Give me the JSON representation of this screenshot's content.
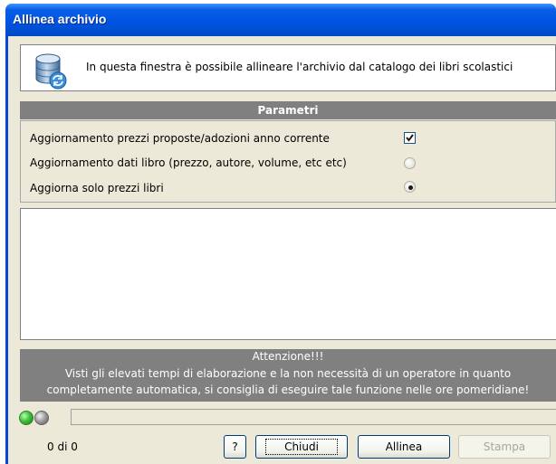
{
  "window": {
    "title": "Allinea archivio"
  },
  "info": {
    "text": "In questa finestra è possibile allineare l'archivio dal catalogo dei libri scolastici",
    "icon": "database-sync-icon"
  },
  "parameters": {
    "header": "Parametri",
    "options": [
      {
        "label": "Aggiornamento prezzi proposte/adozioni anno corrente",
        "control": "checkbox",
        "checked": true
      },
      {
        "label": "Aggiornamento dati libro (prezzo, autore, volume, etc etc)",
        "control": "radio",
        "checked": false
      },
      {
        "label": "Aggiorna solo prezzi libri",
        "control": "radio",
        "checked": true
      }
    ]
  },
  "warning": {
    "title": "Attenzione!!!",
    "line1": "Visti gli elevati tempi di elaborazione e la non necessità di un operatore in quanto",
    "line2": "completamente automatica, si consiglia di eseguire tale funzione nelle ore pomeridiane!"
  },
  "status": {
    "counter": "0 di 0",
    "progress": 0,
    "indicators": [
      "green",
      "gray"
    ]
  },
  "buttons": {
    "help": "?",
    "close": "Chiudi",
    "align": "Allinea",
    "print": "Stampa",
    "print_enabled": false
  },
  "colors": {
    "titlebar": "#0054e3",
    "dialog_bg": "#ece9d8",
    "header_bg": "#808080",
    "header_text": "#ffffff"
  }
}
